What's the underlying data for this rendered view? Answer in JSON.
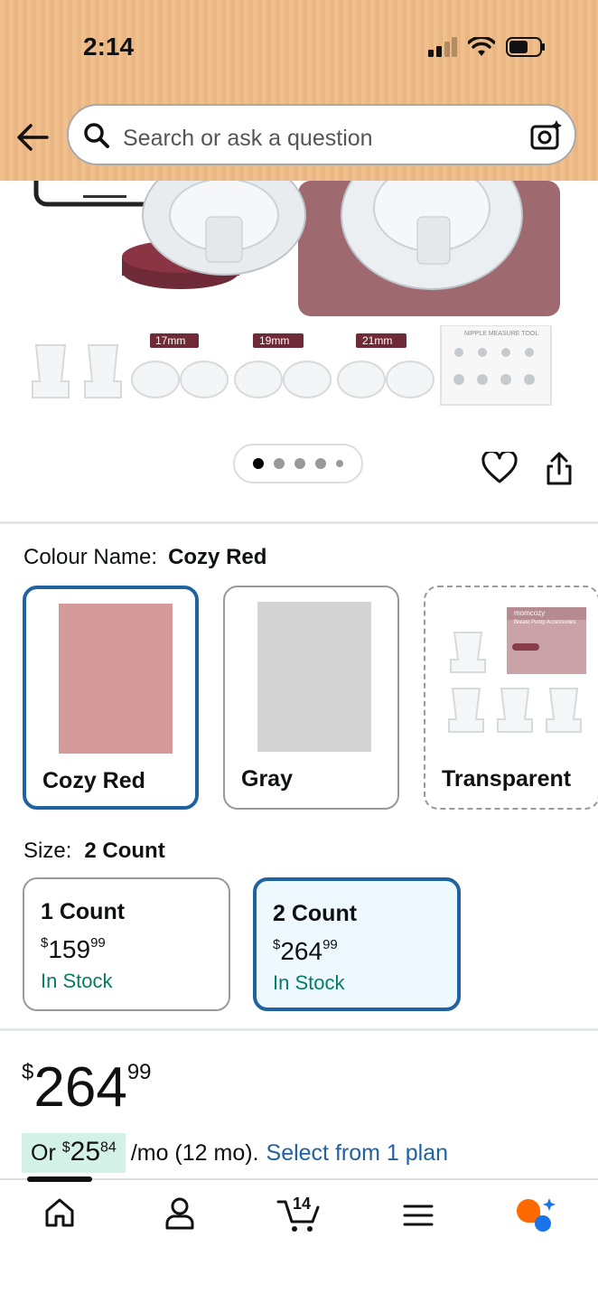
{
  "status_bar": {
    "time": "2:14"
  },
  "search": {
    "placeholder": "Search or ask a question"
  },
  "thumbnails": {
    "sizes": [
      "17mm",
      "19mm",
      "21mm"
    ],
    "tool_label": "NIPPLE MEASURE TOOL"
  },
  "carousel": {
    "dots": 5,
    "active_index": 0
  },
  "colour": {
    "label": "Colour Name:",
    "selected": "Cozy Red",
    "options": [
      {
        "name": "Cozy Red",
        "color": "#d49b9a",
        "selected": true
      },
      {
        "name": "Gray",
        "color": "#d3d3d3",
        "selected": false
      },
      {
        "name": "Transparent",
        "box_brand": "momcozy",
        "box_title": "Breast Pump Accessories",
        "selected": false
      }
    ]
  },
  "size": {
    "label": "Size:",
    "selected": "2 Count",
    "options": [
      {
        "name": "1 Count",
        "currency": "$",
        "price_whole": "159",
        "price_cents": "99",
        "stock": "In Stock",
        "selected": false
      },
      {
        "name": "2 Count",
        "currency": "$",
        "price_whole": "264",
        "price_cents": "99",
        "stock": "In Stock",
        "selected": true
      }
    ]
  },
  "price": {
    "currency": "$",
    "whole": "264",
    "cents": "99"
  },
  "monthly": {
    "prefix": "Or",
    "currency": "$",
    "whole": "25",
    "cents": "84",
    "suffix": "/mo (12 mo).",
    "link": "Select from 1 plan"
  },
  "nav": {
    "cart_count": "14",
    "items": [
      "home",
      "account",
      "cart",
      "menu",
      "rufus"
    ]
  },
  "colors": {
    "accent": "#2162a1",
    "stock_green": "#067d62",
    "selected_bg": "#edf8ff",
    "header": "#f0c08c"
  }
}
